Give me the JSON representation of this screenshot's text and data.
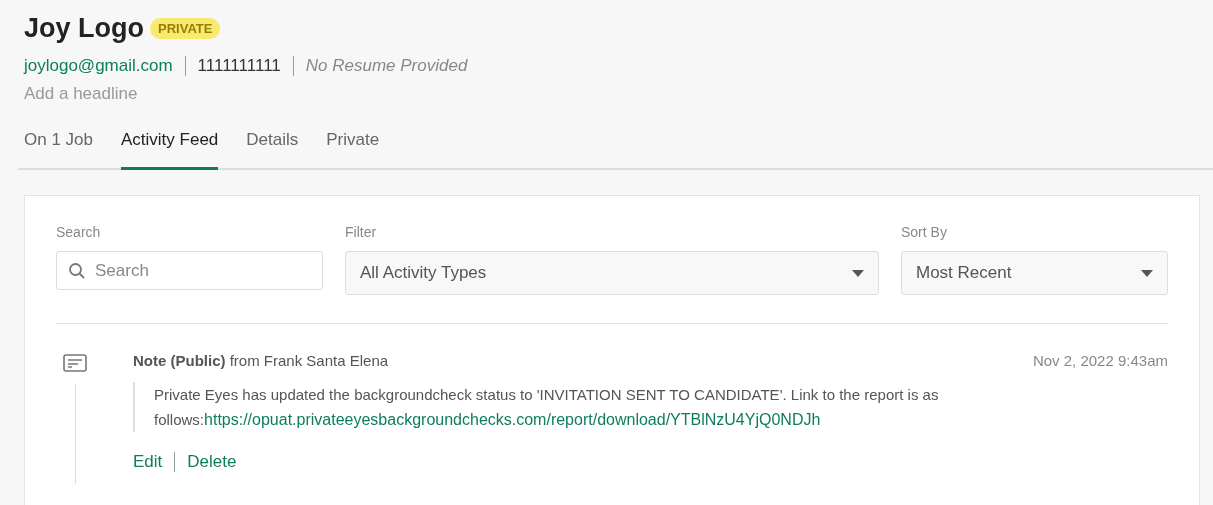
{
  "candidate": {
    "name": "Joy Logo",
    "badge": "PRIVATE",
    "email": "joylogo@gmail.com",
    "phone": "1111111111",
    "resume": "No Resume Provided",
    "headline_placeholder": "Add a headline"
  },
  "tabs": [
    {
      "label": "On 1 Job",
      "selected": false
    },
    {
      "label": "Activity Feed",
      "selected": true
    },
    {
      "label": "Details",
      "selected": false
    },
    {
      "label": "Private",
      "selected": false
    }
  ],
  "filters": {
    "search": {
      "label": "Search",
      "placeholder": "Search"
    },
    "filter": {
      "label": "Filter",
      "value": "All Activity Types"
    },
    "sort": {
      "label": "Sort By",
      "value": "Most Recent"
    }
  },
  "activities": [
    {
      "title": "Note (Public)",
      "author": "from Frank Santa Elena",
      "time": "Nov 2, 2022 9:43am",
      "text": "Private Eyes has updated the backgroundcheck status to 'INVITATION SENT TO CANDIDATE'. Link to the report is as follows:",
      "link": "https://opuat.privateeyesbackgroundchecks.com/report/download/YTBlNzU4YjQ0NDJh",
      "actions": [
        "Edit",
        "Delete"
      ]
    }
  ]
}
